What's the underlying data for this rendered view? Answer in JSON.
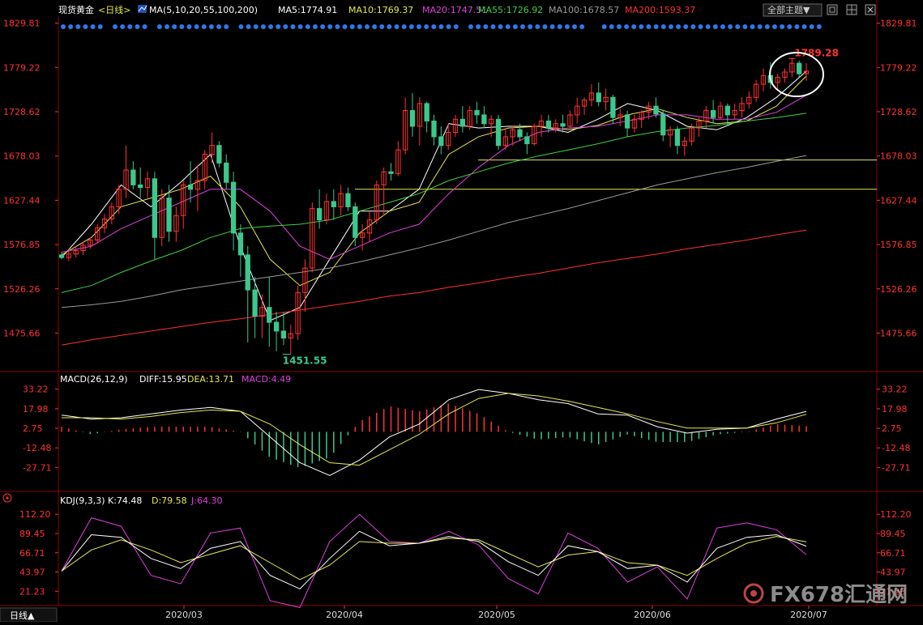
{
  "header": {
    "symbol": "现货黄金",
    "period_tag": "<日线>",
    "ma_label": "MA(5,10,20,55,100,200)",
    "ma_values": [
      {
        "label": "MA5:1774.91",
        "color": "#ffffff"
      },
      {
        "label": "MA10:1769.37",
        "color": "#e8e850"
      },
      {
        "label": "MA20:1747.51",
        "color": "#e040e0"
      },
      {
        "label": "MA55:1726.92",
        "color": "#40d040"
      },
      {
        "label": "MA100:1678.57",
        "color": "#9a9a9a"
      },
      {
        "label": "MA200:1593.37",
        "color": "#ff3030"
      }
    ],
    "theme_button": "全部主题▼"
  },
  "footer": {
    "period_button": "日线▲",
    "watermark": "FX678汇通网"
  },
  "colors": {
    "up": "#ff3232",
    "down": "#54ffff",
    "down_fill": "#3cc88c",
    "axis": "#ff3232",
    "grid_line": "#8b0000",
    "hline": "#e8e850"
  },
  "chart_data": [
    {
      "type": "candlestick",
      "name": "现货黄金 日线",
      "x_ticks": [
        "2020/03",
        "2020/04",
        "2020/05",
        "2020/06",
        "2020/07"
      ],
      "y_ticks": [
        "1829.81",
        "1779.22",
        "1728.62",
        "1678.03",
        "1627.44",
        "1576.85",
        "1526.26",
        "1475.66"
      ],
      "ylim": [
        1440,
        1835
      ],
      "high_label": "1789.28",
      "low_label": "1451.55",
      "support_lines": [
        1673.5,
        1640.0
      ],
      "ohlc": [
        [
          1565,
          1568,
          1560,
          1562
        ],
        [
          1562,
          1572,
          1558,
          1566
        ],
        [
          1566,
          1575,
          1562,
          1570
        ],
        [
          1570,
          1580,
          1565,
          1576
        ],
        [
          1576,
          1585,
          1572,
          1582
        ],
        [
          1582,
          1600,
          1578,
          1596
        ],
        [
          1596,
          1612,
          1590,
          1606
        ],
        [
          1606,
          1625,
          1600,
          1620
        ],
        [
          1620,
          1645,
          1612,
          1640
        ],
        [
          1640,
          1690,
          1630,
          1662
        ],
        [
          1662,
          1672,
          1640,
          1645
        ],
        [
          1645,
          1665,
          1630,
          1642
        ],
        [
          1642,
          1660,
          1630,
          1652
        ],
        [
          1652,
          1660,
          1560,
          1585
        ],
        [
          1585,
          1640,
          1575,
          1630
        ],
        [
          1630,
          1645,
          1580,
          1592
        ],
        [
          1592,
          1620,
          1580,
          1610
        ],
        [
          1610,
          1650,
          1595,
          1645
        ],
        [
          1645,
          1672,
          1625,
          1640
        ],
        [
          1640,
          1668,
          1615,
          1650
        ],
        [
          1650,
          1685,
          1640,
          1680
        ],
        [
          1680,
          1705,
          1670,
          1690
        ],
        [
          1690,
          1695,
          1665,
          1670
        ],
        [
          1670,
          1680,
          1640,
          1648
        ],
        [
          1648,
          1660,
          1570,
          1590
        ],
        [
          1590,
          1600,
          1540,
          1565
        ],
        [
          1565,
          1575,
          1465,
          1525
        ],
        [
          1525,
          1540,
          1470,
          1495
        ],
        [
          1495,
          1520,
          1470,
          1505
        ],
        [
          1505,
          1540,
          1460,
          1488
        ],
        [
          1488,
          1500,
          1455,
          1478
        ],
        [
          1478,
          1500,
          1462,
          1470
        ],
        [
          1470,
          1485,
          1451.55,
          1475
        ],
        [
          1475,
          1530,
          1468,
          1522
        ],
        [
          1522,
          1560,
          1500,
          1550
        ],
        [
          1550,
          1625,
          1545,
          1618
        ],
        [
          1618,
          1640,
          1595,
          1605
        ],
        [
          1605,
          1635,
          1600,
          1626
        ],
        [
          1626,
          1640,
          1605,
          1620
        ],
        [
          1620,
          1645,
          1610,
          1635
        ],
        [
          1635,
          1642,
          1615,
          1620
        ],
        [
          1620,
          1625,
          1575,
          1585
        ],
        [
          1585,
          1600,
          1570,
          1590
        ],
        [
          1590,
          1615,
          1580,
          1605
        ],
        [
          1605,
          1650,
          1600,
          1645
        ],
        [
          1645,
          1665,
          1610,
          1660
        ],
        [
          1660,
          1670,
          1650,
          1658
        ],
        [
          1658,
          1695,
          1655,
          1685
        ],
        [
          1685,
          1745,
          1680,
          1730
        ],
        [
          1730,
          1750,
          1700,
          1712
        ],
        [
          1712,
          1745,
          1690,
          1738
        ],
        [
          1738,
          1740,
          1705,
          1718
        ],
        [
          1718,
          1725,
          1690,
          1700
        ],
        [
          1700,
          1712,
          1680,
          1690
        ],
        [
          1690,
          1715,
          1685,
          1705
        ],
        [
          1705,
          1725,
          1700,
          1720
        ],
        [
          1720,
          1735,
          1705,
          1712
        ],
        [
          1712,
          1735,
          1708,
          1730
        ],
        [
          1730,
          1740,
          1715,
          1725
        ],
        [
          1725,
          1735,
          1710,
          1715
        ],
        [
          1715,
          1725,
          1700,
          1720
        ],
        [
          1720,
          1725,
          1685,
          1690
        ],
        [
          1690,
          1710,
          1685,
          1700
        ],
        [
          1700,
          1712,
          1690,
          1708
        ],
        [
          1708,
          1715,
          1695,
          1700
        ],
        [
          1700,
          1705,
          1680,
          1692
        ],
        [
          1692,
          1715,
          1690,
          1712
        ],
        [
          1712,
          1725,
          1700,
          1718
        ],
        [
          1718,
          1725,
          1705,
          1710
        ],
        [
          1710,
          1720,
          1705,
          1715
        ],
        [
          1715,
          1725,
          1705,
          1712
        ],
        [
          1712,
          1730,
          1710,
          1725
        ],
        [
          1725,
          1745,
          1715,
          1735
        ],
        [
          1735,
          1745,
          1725,
          1742
        ],
        [
          1742,
          1760,
          1735,
          1750
        ],
        [
          1750,
          1762,
          1735,
          1740
        ],
        [
          1740,
          1755,
          1730,
          1745
        ],
        [
          1745,
          1748,
          1715,
          1722
        ],
        [
          1722,
          1732,
          1712,
          1725
        ],
        [
          1725,
          1730,
          1700,
          1710
        ],
        [
          1710,
          1725,
          1705,
          1720
        ],
        [
          1720,
          1730,
          1710,
          1728
        ],
        [
          1728,
          1740,
          1720,
          1735
        ],
        [
          1735,
          1745,
          1722,
          1726
        ],
        [
          1726,
          1730,
          1695,
          1702
        ],
        [
          1702,
          1712,
          1688,
          1708
        ],
        [
          1708,
          1712,
          1680,
          1690
        ],
        [
          1690,
          1700,
          1678,
          1695
        ],
        [
          1695,
          1715,
          1690,
          1710
        ],
        [
          1710,
          1722,
          1700,
          1718
        ],
        [
          1718,
          1735,
          1710,
          1730
        ],
        [
          1730,
          1742,
          1715,
          1722
        ],
        [
          1722,
          1740,
          1720,
          1735
        ],
        [
          1735,
          1738,
          1712,
          1725
        ],
        [
          1725,
          1738,
          1720,
          1730
        ],
        [
          1730,
          1745,
          1722,
          1738
        ],
        [
          1738,
          1752,
          1732,
          1745
        ],
        [
          1745,
          1765,
          1740,
          1760
        ],
        [
          1760,
          1778,
          1752,
          1770
        ],
        [
          1770,
          1785,
          1755,
          1762
        ],
        [
          1762,
          1772,
          1755,
          1768
        ],
        [
          1768,
          1778,
          1762,
          1774
        ],
        [
          1774,
          1789.28,
          1768,
          1784
        ],
        [
          1784,
          1787,
          1768,
          1772
        ],
        [
          1772,
          1784,
          1764,
          1775
        ]
      ],
      "moving_averages": [
        {
          "name": "MA5",
          "color": "#ffffff",
          "values": [
            1562,
            1600,
            1645,
            1620,
            1648,
            1680,
            1575,
            1490,
            1505,
            1560,
            1615,
            1615,
            1640,
            1715,
            1710,
            1712,
            1712,
            1705,
            1720,
            1738,
            1730,
            1712,
            1708,
            1722,
            1745,
            1774.9
          ]
        },
        {
          "name": "MA10",
          "color": "#e8e850",
          "values": [
            1565,
            1585,
            1620,
            1630,
            1640,
            1655,
            1620,
            1560,
            1530,
            1545,
            1590,
            1615,
            1625,
            1680,
            1700,
            1710,
            1712,
            1708,
            1713,
            1725,
            1732,
            1722,
            1715,
            1718,
            1735,
            1769.4
          ]
        },
        {
          "name": "MA20",
          "color": "#e040e0",
          "values": [
            1568,
            1575,
            1595,
            1610,
            1625,
            1640,
            1640,
            1615,
            1575,
            1560,
            1575,
            1590,
            1600,
            1635,
            1665,
            1690,
            1705,
            1710,
            1712,
            1718,
            1725,
            1725,
            1720,
            1720,
            1728,
            1747.5
          ]
        },
        {
          "name": "MA55",
          "color": "#40d040",
          "values": [
            1522,
            1530,
            1545,
            1558,
            1570,
            1585,
            1595,
            1598,
            1600,
            1605,
            1615,
            1625,
            1635,
            1650,
            1660,
            1670,
            1678,
            1685,
            1692,
            1700,
            1706,
            1710,
            1713,
            1718,
            1722,
            1726.9
          ]
        },
        {
          "name": "MA100",
          "color": "#9a9a9a",
          "values": [
            1505,
            1508,
            1512,
            1518,
            1525,
            1530,
            1535,
            1540,
            1545,
            1550,
            1557,
            1565,
            1573,
            1582,
            1592,
            1602,
            1610,
            1618,
            1627,
            1636,
            1645,
            1652,
            1659,
            1665,
            1672,
            1678.6
          ]
        },
        {
          "name": "MA200",
          "color": "#ff3030",
          "values": [
            1462,
            1468,
            1473,
            1478,
            1483,
            1488,
            1492,
            1497,
            1502,
            1507,
            1512,
            1518,
            1522,
            1528,
            1533,
            1539,
            1544,
            1550,
            1556,
            1561,
            1566,
            1572,
            1577,
            1582,
            1588,
            1593.4
          ]
        }
      ]
    },
    {
      "type": "macd",
      "label": "MACD(26,12,9)",
      "legend": [
        {
          "label": "DIFF:15.95",
          "color": "#ffffff"
        },
        {
          "label": "DEA:13.71",
          "color": "#e8e850"
        },
        {
          "label": "MACD:4.49",
          "color": "#e040e0"
        }
      ],
      "y_ticks": [
        "33.22",
        "17.98",
        "2.75",
        "-12.48",
        "-27.71"
      ],
      "ylim": [
        -42,
        40
      ],
      "diff": [
        13,
        10,
        11,
        14,
        17,
        19,
        16,
        -4,
        -24,
        -34,
        -22,
        -4,
        6,
        25,
        33,
        30,
        25,
        22,
        14,
        13,
        4,
        -1,
        2,
        3,
        10,
        15.95
      ],
      "dea": [
        11,
        11,
        10,
        12,
        15,
        17,
        16,
        6,
        -10,
        -24,
        -26,
        -14,
        -2,
        14,
        26,
        30,
        28,
        24,
        19,
        14,
        8,
        3,
        3,
        3,
        7,
        13.71
      ]
    },
    {
      "type": "kdj",
      "label": "KDJ(9,3,3)",
      "legend": [
        {
          "label": "K:74.48",
          "color": "#ffffff"
        },
        {
          "label": "D:79.58",
          "color": "#e8e850"
        },
        {
          "label": "J:64.30",
          "color": "#e040e0"
        }
      ],
      "y_ticks": [
        "112.20",
        "89.45",
        "66.71",
        "43.97",
        "21.23"
      ],
      "ylim": [
        10,
        122
      ],
      "k": [
        45,
        88,
        85,
        60,
        48,
        72,
        80,
        40,
        24,
        60,
        92,
        75,
        78,
        86,
        80,
        56,
        40,
        75,
        68,
        48,
        52,
        32,
        72,
        85,
        88,
        74.48
      ],
      "d": [
        45,
        70,
        82,
        70,
        55,
        65,
        75,
        55,
        35,
        52,
        80,
        78,
        78,
        84,
        82,
        66,
        50,
        64,
        68,
        55,
        52,
        40,
        60,
        78,
        86,
        79.58
      ],
      "j": [
        45,
        108,
        98,
        40,
        30,
        90,
        96,
        10,
        2,
        80,
        112,
        80,
        78,
        92,
        76,
        36,
        18,
        90,
        72,
        32,
        50,
        12,
        96,
        102,
        94,
        64.3
      ]
    }
  ]
}
